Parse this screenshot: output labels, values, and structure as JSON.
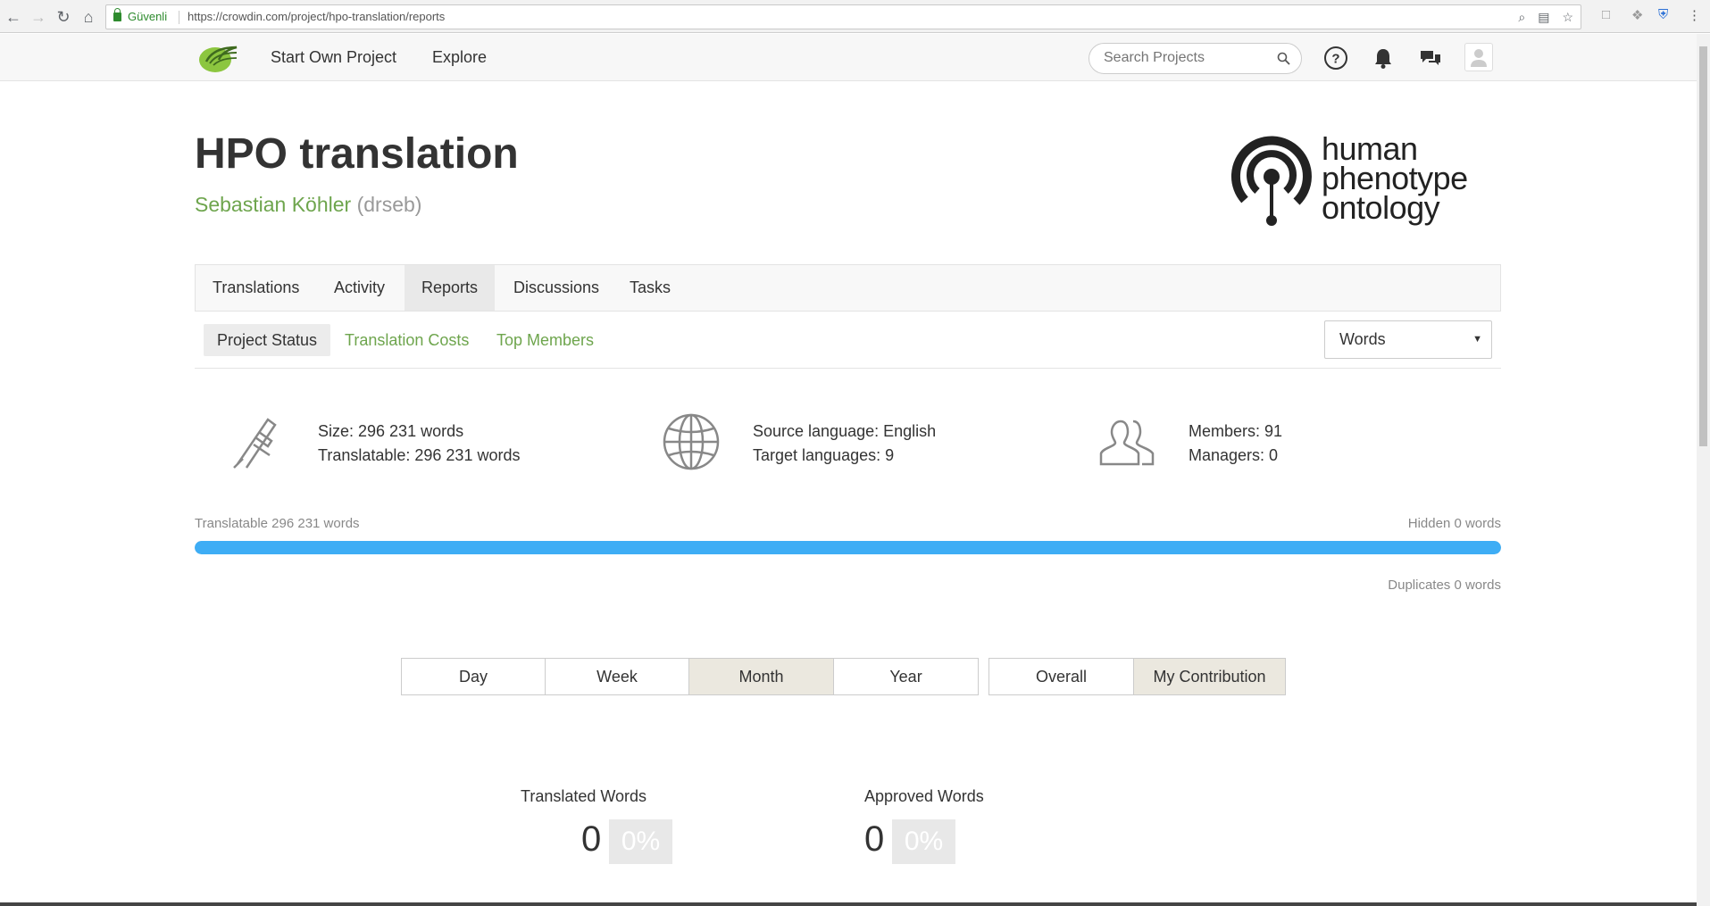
{
  "browser": {
    "secure_label": "Güvenli",
    "url": "https://crowdin.com/project/hpo-translation/reports"
  },
  "header": {
    "nav": [
      "Start Own Project",
      "Explore"
    ],
    "search_placeholder": "Search Projects"
  },
  "project": {
    "title": "HPO translation",
    "owner_name": "Sebastian Köhler",
    "owner_login": "(drseb)",
    "brand_lines": [
      "human",
      "phenotype",
      "ontology"
    ]
  },
  "tabs": [
    "Translations",
    "Activity",
    "Reports",
    "Discussions",
    "Tasks"
  ],
  "active_tab": "Reports",
  "subtabs": [
    "Project Status",
    "Translation Costs",
    "Top Members"
  ],
  "active_subtab": "Project Status",
  "unit_select": "Words",
  "stats": {
    "size": "Size: 296 231 words",
    "translatable": "Translatable: 296 231 words",
    "source_language": "Source language: English",
    "target_languages": "Target languages: 9",
    "members": "Members: 91",
    "managers": "Managers: 0"
  },
  "progress": {
    "translatable_label": "Translatable 296 231 words",
    "hidden_label": "Hidden 0 words",
    "duplicates_label": "Duplicates 0 words",
    "translatable_fraction": 1.0
  },
  "periods": [
    "Day",
    "Week",
    "Month",
    "Year"
  ],
  "active_period": "Month",
  "scopes": [
    "Overall",
    "My Contribution"
  ],
  "active_scope": "My Contribution",
  "metrics": {
    "translated_label": "Translated Words",
    "translated_value": "0",
    "translated_pct": "0%",
    "approved_label": "Approved Words",
    "approved_value": "0",
    "approved_pct": "0%"
  },
  "colors": {
    "accent_green": "#6ea54d",
    "progress_blue": "#3eadf5"
  }
}
